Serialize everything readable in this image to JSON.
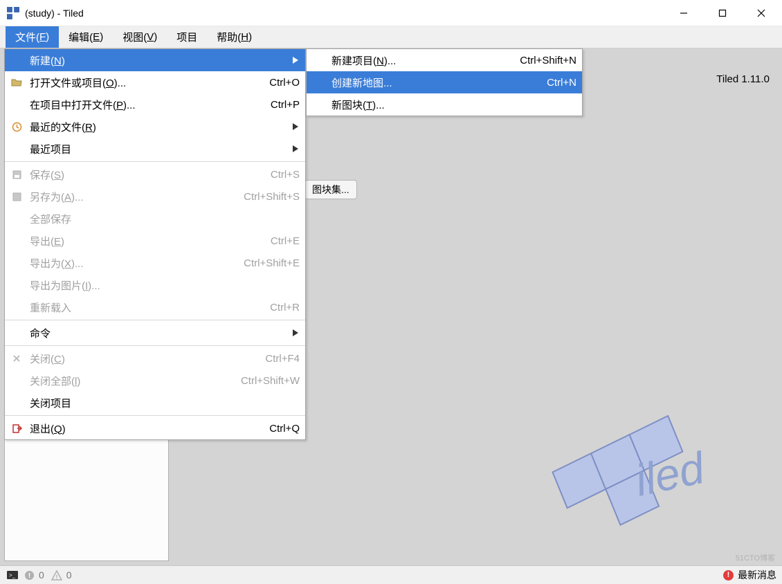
{
  "window": {
    "title": "(study) - Tiled"
  },
  "menubar": {
    "file": "文件(F)",
    "edit": "编辑(E)",
    "view": "视图(V)",
    "project": "项目",
    "help": "帮助(H)"
  },
  "file_menu": {
    "new": {
      "label": "新建(N)",
      "icon": ""
    },
    "open": {
      "label": "打开文件或项目(O)...",
      "shortcut": "Ctrl+O",
      "icon": "folder-open-icon"
    },
    "open_in_project": {
      "label": "在项目中打开文件(P)...",
      "shortcut": "Ctrl+P",
      "icon": ""
    },
    "recent_files": {
      "label": "最近的文件(R)",
      "icon": "clock-icon"
    },
    "recent_projects": {
      "label": "最近项目",
      "icon": ""
    },
    "save": {
      "label": "保存(S)",
      "shortcut": "Ctrl+S",
      "icon": "save-icon",
      "disabled": true
    },
    "save_as": {
      "label": "另存为(A)...",
      "shortcut": "Ctrl+Shift+S",
      "icon": "save-as-icon",
      "disabled": true
    },
    "save_all": {
      "label": "全部保存",
      "icon": "",
      "disabled": true
    },
    "export": {
      "label": "导出(E)",
      "shortcut": "Ctrl+E",
      "icon": "",
      "disabled": true
    },
    "export_as": {
      "label": "导出为(X)...",
      "shortcut": "Ctrl+Shift+E",
      "icon": "",
      "disabled": true
    },
    "export_image": {
      "label": "导出为图片(I)...",
      "icon": "",
      "disabled": true
    },
    "reload": {
      "label": "重新载入",
      "shortcut": "Ctrl+R",
      "icon": "",
      "disabled": true
    },
    "commands": {
      "label": "命令",
      "icon": ""
    },
    "close": {
      "label": "关闭(C)",
      "shortcut": "Ctrl+F4",
      "icon": "close-icon",
      "disabled": true
    },
    "close_all": {
      "label": "关闭全部(l)",
      "shortcut": "Ctrl+Shift+W",
      "icon": "",
      "disabled": true
    },
    "close_project": {
      "label": "关闭项目",
      "icon": ""
    },
    "quit": {
      "label": "退出(Q)",
      "shortcut": "Ctrl+Q",
      "icon": "quit-icon"
    }
  },
  "submenu_new": {
    "new_project": {
      "label": "新建项目(N)...",
      "shortcut": "Ctrl+Shift+N"
    },
    "new_map": {
      "label": "创建新地图...",
      "shortcut": "Ctrl+N"
    },
    "new_tileset": {
      "label": "新图块(T)..."
    }
  },
  "workspace": {
    "version": "Tiled 1.11.0",
    "partial_button": "图块集..."
  },
  "statusbar": {
    "errors": "0",
    "warnings": "0",
    "news": "最新消息"
  },
  "watermark": "51CTO博客"
}
